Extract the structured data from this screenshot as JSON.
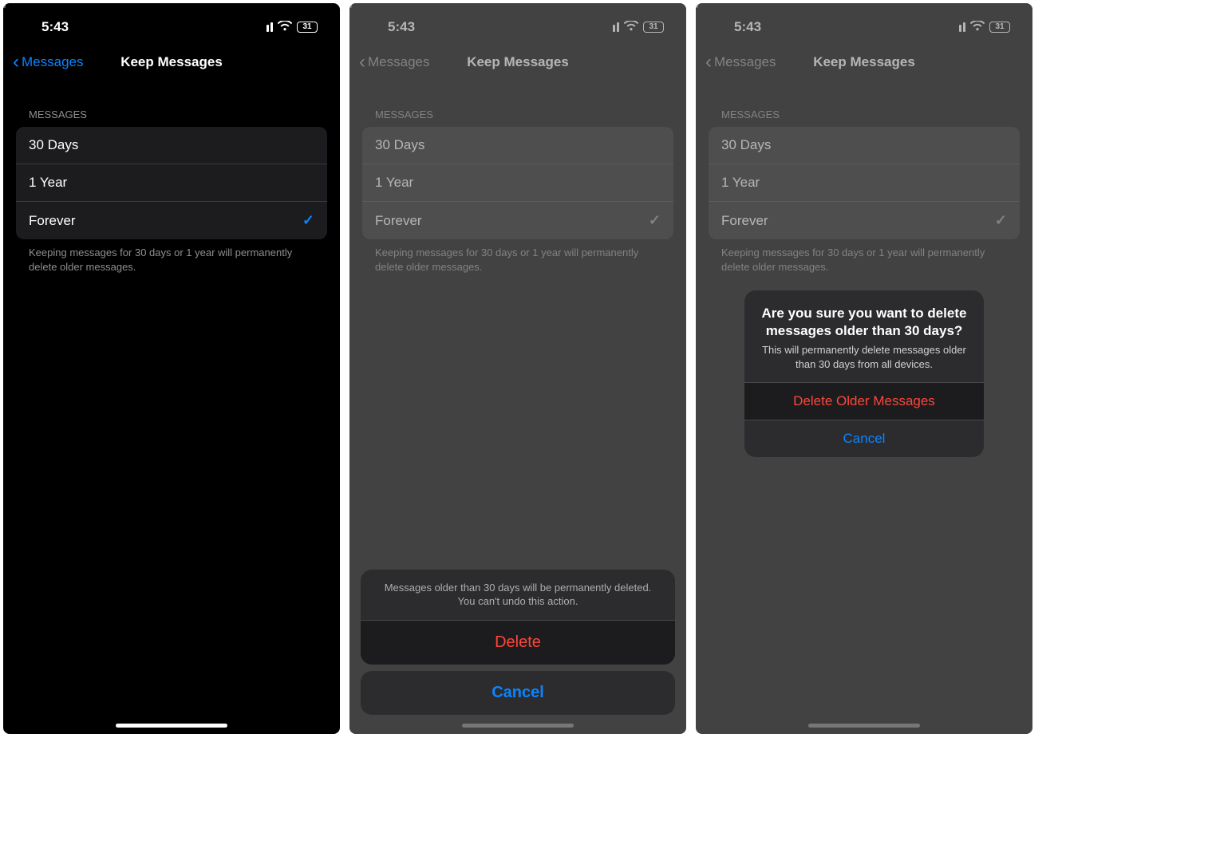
{
  "status": {
    "time": "5:43",
    "battery": "31"
  },
  "nav": {
    "back_label": "Messages",
    "title": "Keep Messages"
  },
  "section_header": "MESSAGES",
  "options": {
    "opt_30": "30 Days",
    "opt_1yr": "1 Year",
    "opt_forever": "Forever"
  },
  "footer": "Keeping messages for 30 days or 1 year will permanently delete older messages.",
  "sheet": {
    "message": "Messages older than 30 days will be permanently deleted. You can't undo this action.",
    "delete": "Delete",
    "cancel": "Cancel"
  },
  "alert": {
    "title": "Are you sure you want to delete messages older than 30 days?",
    "subtitle": "This will permanently delete messages older than 30 days from all devices.",
    "delete": "Delete Older Messages",
    "cancel": "Cancel"
  }
}
